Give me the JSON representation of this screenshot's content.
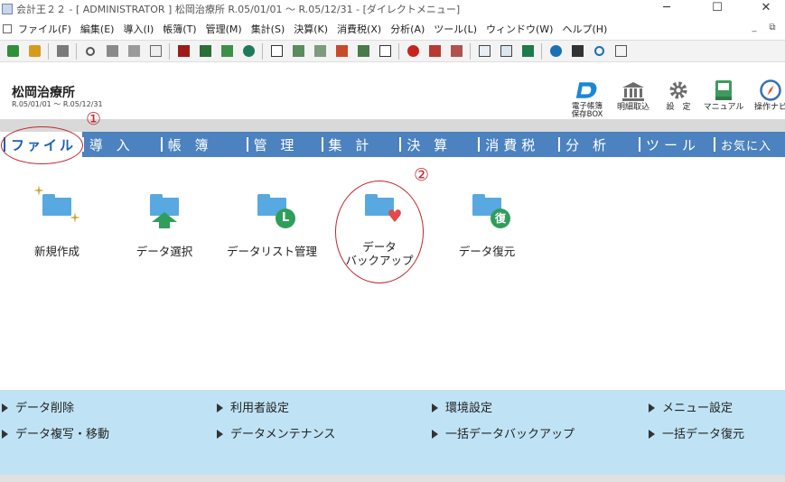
{
  "window": {
    "title": "会計王２２ - [ ADMINISTRATOR ] 松岡治療所 R.05/01/01 〜 R.05/12/31 - [ダイレクトメニュー]",
    "minimize": "─",
    "maximize": "☐",
    "close": "✕"
  },
  "menubar": {
    "items": [
      "ファイル(F)",
      "編集(E)",
      "導入(I)",
      "帳簿(T)",
      "管理(M)",
      "集計(S)",
      "決算(K)",
      "消費税(X)",
      "分析(A)",
      "ツール(L)",
      "ウィンドウ(W)",
      "ヘルプ(H)"
    ],
    "mdi_minimize": "_",
    "mdi_restore": "⧉"
  },
  "header": {
    "company": "松岡治療所",
    "period": "R.05/01/01 〜 R.05/12/31",
    "buttons": [
      {
        "label": "電子帳簿\n保存BOX"
      },
      {
        "label": "明細取込"
      },
      {
        "label": "設　定"
      },
      {
        "label": "マニュアル"
      },
      {
        "label": "操作ナビ"
      }
    ]
  },
  "tabs": [
    "ファイル",
    "導 入",
    "帳 簿",
    "管 理",
    "集 計",
    "決 算",
    "消費税",
    "分 析",
    "ツール",
    "お気に入"
  ],
  "annotations": {
    "one": "①",
    "two": "②"
  },
  "functions": [
    {
      "label": "新規作成",
      "badge": ""
    },
    {
      "label": "データ選択",
      "badge": ""
    },
    {
      "label": "データリスト管理",
      "badge": "L"
    },
    {
      "label": "データ\nバックアップ",
      "badge": "♥"
    },
    {
      "label": "データ復元",
      "badge": "復"
    }
  ],
  "links": [
    "データ削除",
    "利用者設定",
    "環境設定",
    "メニュー設定",
    "データ複写・移動",
    "データメンテナンス",
    "一括データバックアップ",
    "一括データ復元"
  ],
  "colors": {
    "tab_bar": "#4b82bf",
    "bottom_panel": "#bfe3f5",
    "annotation": "#c1272d",
    "folder": "#58a9e1"
  }
}
